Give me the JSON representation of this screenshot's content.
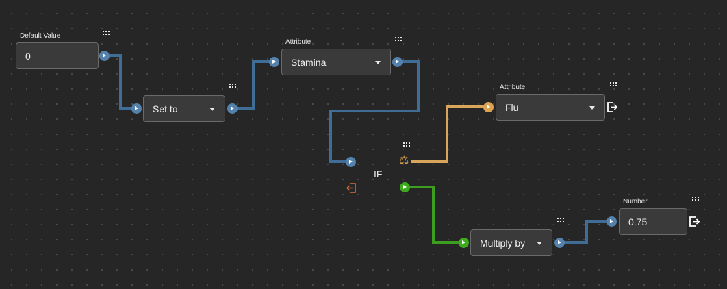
{
  "colors": {
    "background": "#262626",
    "link_blue": "#3f6d96",
    "link_yellow": "#d9a55a",
    "link_green": "#3c9d1e",
    "port_blue": "#5482ad",
    "port_yellow": "#dca452",
    "port_green": "#3eab1f",
    "exit_red": "#d96a3a"
  },
  "nodes": {
    "default_value": {
      "label": "Default Value",
      "value": "0"
    },
    "set_to": {
      "value": "Set to"
    },
    "attribute_stamina": {
      "label": "Attribute",
      "value": "Stamina"
    },
    "attribute_flu": {
      "label": "Attribute",
      "value": "Flu"
    },
    "if_node": {
      "label": "IF",
      "compare_icon": "⚖"
    },
    "multiply_by": {
      "value": "Multiply by"
    },
    "number": {
      "label": "Number",
      "value": "0.75"
    }
  },
  "icons": {
    "drag_handle": "drag-handle-icon",
    "exit": "exit-icon",
    "compare": "balance-scale-icon",
    "output_port": "play-port-icon",
    "dropdown": "dropdown-caret-icon"
  }
}
